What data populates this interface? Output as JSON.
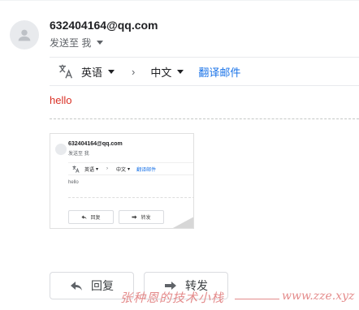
{
  "header": {
    "sender_email": "632404164@qq.com",
    "sent_to_label": "发送至 我"
  },
  "translate_bar": {
    "source_language": "英语",
    "target_language": "中文",
    "translate_link": "翻译邮件"
  },
  "message": {
    "body_text": "hello"
  },
  "thumbnail": {
    "sender_email": "632404164@qq.com",
    "sent_to_label": "发送至 我",
    "source_language": "英语",
    "target_language": "中文",
    "translate_link": "翻译邮件",
    "body_text": "hello",
    "reply_label": "回复",
    "forward_label": "转发"
  },
  "actions": {
    "reply_label": "回复",
    "forward_label": "转发"
  },
  "watermark": {
    "author_text": "张种恩的技术小栈",
    "site_text": "www.zze.xyz"
  },
  "colors": {
    "link": "#1a73e8",
    "body_text": "#d93025",
    "watermark": "#e48b8b"
  }
}
